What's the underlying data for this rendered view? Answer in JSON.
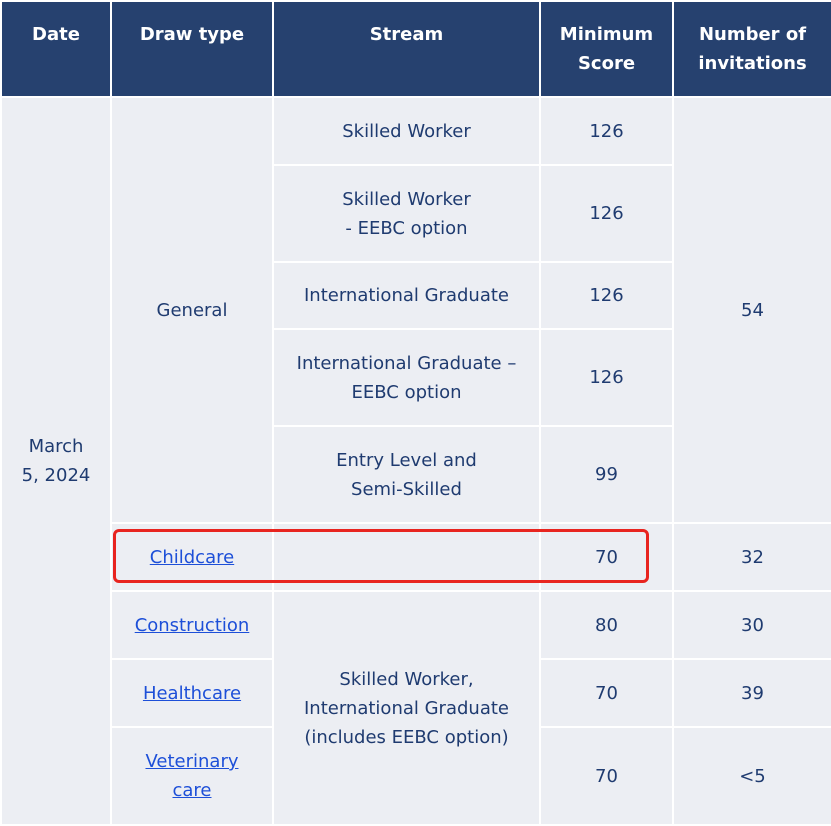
{
  "headers": {
    "date": "Date",
    "draw_type": "Draw type",
    "stream": "Stream",
    "min_score_line1": "Minimum",
    "min_score_line2": "Score",
    "invitations_line1": "Number of",
    "invitations_line2": "invitations"
  },
  "date": {
    "line1": "March",
    "line2": "5, 2024"
  },
  "general": {
    "draw_type": "General",
    "invitations": "54",
    "rows": [
      {
        "stream_line1": "Skilled Worker",
        "stream_line2": "",
        "score": "126"
      },
      {
        "stream_line1": "Skilled Worker",
        "stream_line2": "- EEBC option",
        "score": "126"
      },
      {
        "stream_line1": "International Graduate",
        "stream_line2": "",
        "score": "126"
      },
      {
        "stream_line1": "International Graduate –",
        "stream_line2": "EEBC option",
        "score": "126"
      },
      {
        "stream_line1": "Entry Level and",
        "stream_line2": "Semi-Skilled",
        "score": "99"
      }
    ]
  },
  "childcare": {
    "draw_type": "Childcare",
    "stream": "",
    "score": "70",
    "invitations": "32"
  },
  "targeted_stream": {
    "line1": "Skilled Worker,",
    "line2": "International Graduate",
    "line3": "(includes EEBC option)"
  },
  "targeted_rows": [
    {
      "draw_type_line1": "Construction",
      "draw_type_line2": "",
      "score": "80",
      "invitations": "30"
    },
    {
      "draw_type_line1": "Healthcare",
      "draw_type_line2": "",
      "score": "70",
      "invitations": "39"
    },
    {
      "draw_type_line1": "Veterinary",
      "draw_type_line2": "care",
      "score": "70",
      "invitations": "<5"
    }
  ],
  "colors": {
    "header_bg": "#26416f",
    "cell_bg": "#eceef3",
    "text": "#1f3b70",
    "link": "#1d4fd8",
    "highlight": "#e8241f"
  }
}
